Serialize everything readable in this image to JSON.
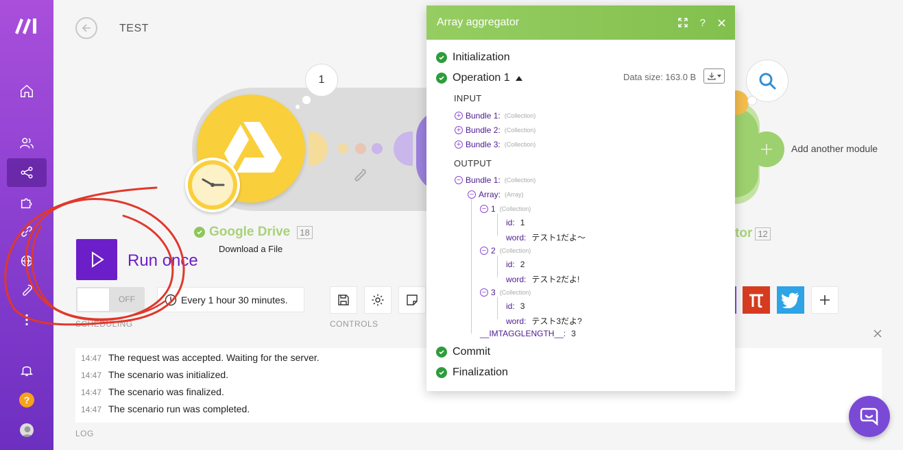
{
  "header": {
    "title": "TEST"
  },
  "canvas": {
    "google_drive": {
      "name": "Google Drive",
      "id_badge": "18",
      "subtitle": "Download a File"
    },
    "bubble_count": "1",
    "aggregator_name_tail": "tor",
    "aggregator_badge": "12",
    "add_module_label": "Add another module"
  },
  "controls": {
    "run_once_label": "Run once",
    "toggle_state": "OFF",
    "schedule_text": "Every 1 hour 30 minutes.",
    "scheduling_label": "SCHEDULING",
    "controls_label": "CONTROLS"
  },
  "modal": {
    "title": "Array aggregator",
    "initialization": "Initialization",
    "operation": "Operation 1",
    "data_size": "Data size: 163.0 B",
    "input_label": "INPUT",
    "output_label": "OUTPUT",
    "input_bundles": [
      {
        "key": "Bundle 1:",
        "type": "(Collection)"
      },
      {
        "key": "Bundle 2:",
        "type": "(Collection)"
      },
      {
        "key": "Bundle 3:",
        "type": "(Collection)"
      }
    ],
    "output": {
      "bundle": {
        "key": "Bundle 1:",
        "type": "(Collection)"
      },
      "array": {
        "key": "Array:",
        "type": "(Array)"
      },
      "items": [
        {
          "key": "1",
          "type": "(Collection)",
          "id_key": "id:",
          "id": "1",
          "word_key": "word:",
          "word": "テスト1だよ〜"
        },
        {
          "key": "2",
          "type": "(Collection)",
          "id_key": "id:",
          "id": "2",
          "word_key": "word:",
          "word": "テスト2だよ!"
        },
        {
          "key": "3",
          "type": "(Collection)",
          "id_key": "id:",
          "id": "3",
          "word_key": "word:",
          "word": "テスト3だよ?"
        }
      ],
      "length_key": "__IMTAGGLENGTH__:",
      "length": "3"
    },
    "commit": "Commit",
    "finalization": "Finalization"
  },
  "log": {
    "label": "LOG",
    "rows": [
      {
        "time": "14:47",
        "text": "The request was accepted. Waiting for the server."
      },
      {
        "time": "14:47",
        "text": "The scenario was initialized."
      },
      {
        "time": "14:47",
        "text": "The scenario was finalized."
      },
      {
        "time": "14:47",
        "text": "The scenario run was completed."
      }
    ]
  },
  "colors": {
    "brand_purple": "#6c1ec9",
    "module_green": "#96cd62",
    "gdrive_yellow": "#f9cf3c",
    "annotation_red": "#e0382b"
  }
}
